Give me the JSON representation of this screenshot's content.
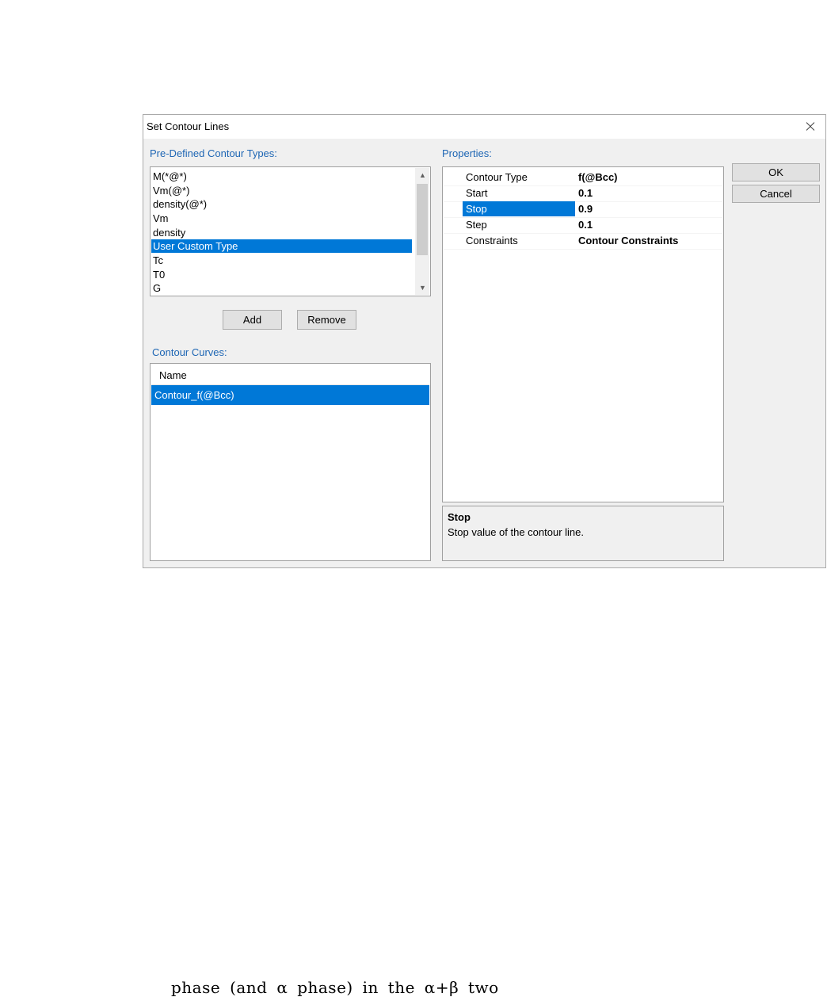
{
  "window": {
    "title": "Set Contour Lines"
  },
  "predefined": {
    "label": "Pre-Defined Contour Types:",
    "items": [
      "M(*@*)",
      "Vm(@*)",
      "density(@*)",
      "Vm",
      "density",
      "User Custom Type",
      "Tc",
      "T0",
      "G"
    ],
    "selected_index": 5
  },
  "buttons": {
    "add": "Add",
    "remove": "Remove",
    "ok": "OK",
    "cancel": "Cancel"
  },
  "contour_curves": {
    "label": "Contour Curves:",
    "column": "Name",
    "rows": [
      "Contour_f(@Bcc)"
    ]
  },
  "properties": {
    "label": "Properties:",
    "rows": [
      {
        "name": "Contour Type",
        "value": "f(@Bcc)"
      },
      {
        "name": "Start",
        "value": "0.1"
      },
      {
        "name": "Stop",
        "value": "0.9"
      },
      {
        "name": "Step",
        "value": "0.1"
      },
      {
        "name": "Constraints",
        "value": "Contour Constraints"
      }
    ],
    "selected_index": 2
  },
  "description": {
    "title": "Stop",
    "text": "Stop value of the contour line."
  },
  "page_text": "phase (and α phase) in the α+β two",
  "colors": {
    "accent": "#0078d7",
    "label": "#1e66b4"
  }
}
